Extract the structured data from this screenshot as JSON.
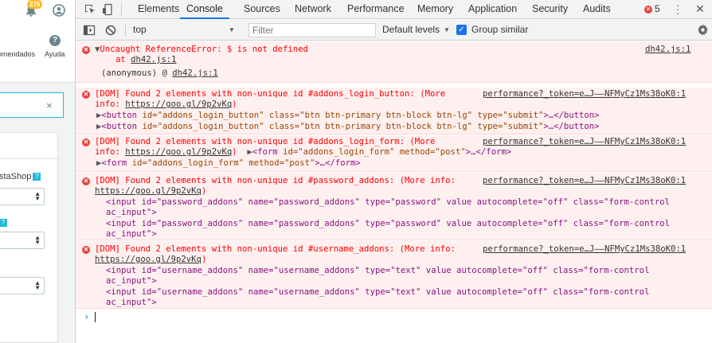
{
  "host": {
    "notification_count": "276",
    "link_recommended": "omendados",
    "link_help": "Ayuda",
    "help_glyph": "?",
    "clear_glyph": "×",
    "field1_label": "staShop",
    "qmark": "?"
  },
  "devtools": {
    "tabs": [
      "Elements",
      "Console",
      "Sources",
      "Network",
      "Performance",
      "Memory",
      "Application",
      "Security",
      "Audits"
    ],
    "active_tab": "Console",
    "error_count": "5",
    "toolbar": {
      "context": "top",
      "filter_placeholder": "Filter",
      "levels": "Default levels",
      "group_similar": "Group similar"
    }
  },
  "messages": {
    "m1": {
      "text": "Uncaught ReferenceError: $ is not defined",
      "at_prefix": "at ",
      "at_link": "dh42.js:1",
      "anon_prefix": "(anonymous) @ ",
      "anon_link": "dh42.js:1",
      "source": "dh42.js:1"
    },
    "m2": {
      "line1": "[DOM] Found 2 elements with non-unique id #addons_login_button: (More",
      "line2_prefix": "info: ",
      "url": "https://goo.gl/9p2vKq",
      "close_paren": ")",
      "source": "performance?_token=e…J——NFMyCz1Ms38oK0:1",
      "node_attrs": "class=\"btn btn-primary btn-block btn-lg\" type=\"submit\"",
      "node_id": "id=\"addons_login_button\"",
      "node_tag": "button",
      "node_tail": ">…</button>"
    },
    "m3": {
      "line1": "[DOM] Found 2 elements with non-unique id #addons_login_form: (More",
      "line2_prefix": "info: ",
      "url": "https://goo.gl/9p2vKq",
      "close_paren": ")",
      "source": "performance?_token=e…J——NFMyCz1Ms38oK0:1",
      "node_tag": "form",
      "node_id": "id=\"addons_login_form\"",
      "node_attrs": "method=\"post\"",
      "node_tail": ">…</form>"
    },
    "m4": {
      "line1": "[DOM] Found 2 elements with non-unique id #password_addons: (More info:",
      "url": "https://goo.gl/9p2vKq",
      "close_paren": ")",
      "source": "performance?_token=e…J——NFMyCz1Ms38oK0:1",
      "node_line1": "<input id=\"password_addons\" name=\"password_addons\" type=\"password\" value autocomplete=\"off\" class=\"form-control",
      "node_line2": "ac_input\">"
    },
    "m5": {
      "line1": "[DOM] Found 2 elements with non-unique id #username_addons: (More info:",
      "url": "https://goo.gl/9p2vKq",
      "close_paren": ")",
      "source": "performance?_token=e…J——NFMyCz1Ms38oK0:1",
      "node_line1": "<input id=\"username_addons\" name=\"username_addons\" type=\"text\" value autocomplete=\"off\" class=\"form-control",
      "node_line2": "ac_input\">"
    }
  },
  "colors": {
    "error_red": "#fe0000",
    "error_bg": "#fff0f0",
    "accent_blue": "#1a73e8",
    "badge_yellow": "#fbbb22"
  }
}
